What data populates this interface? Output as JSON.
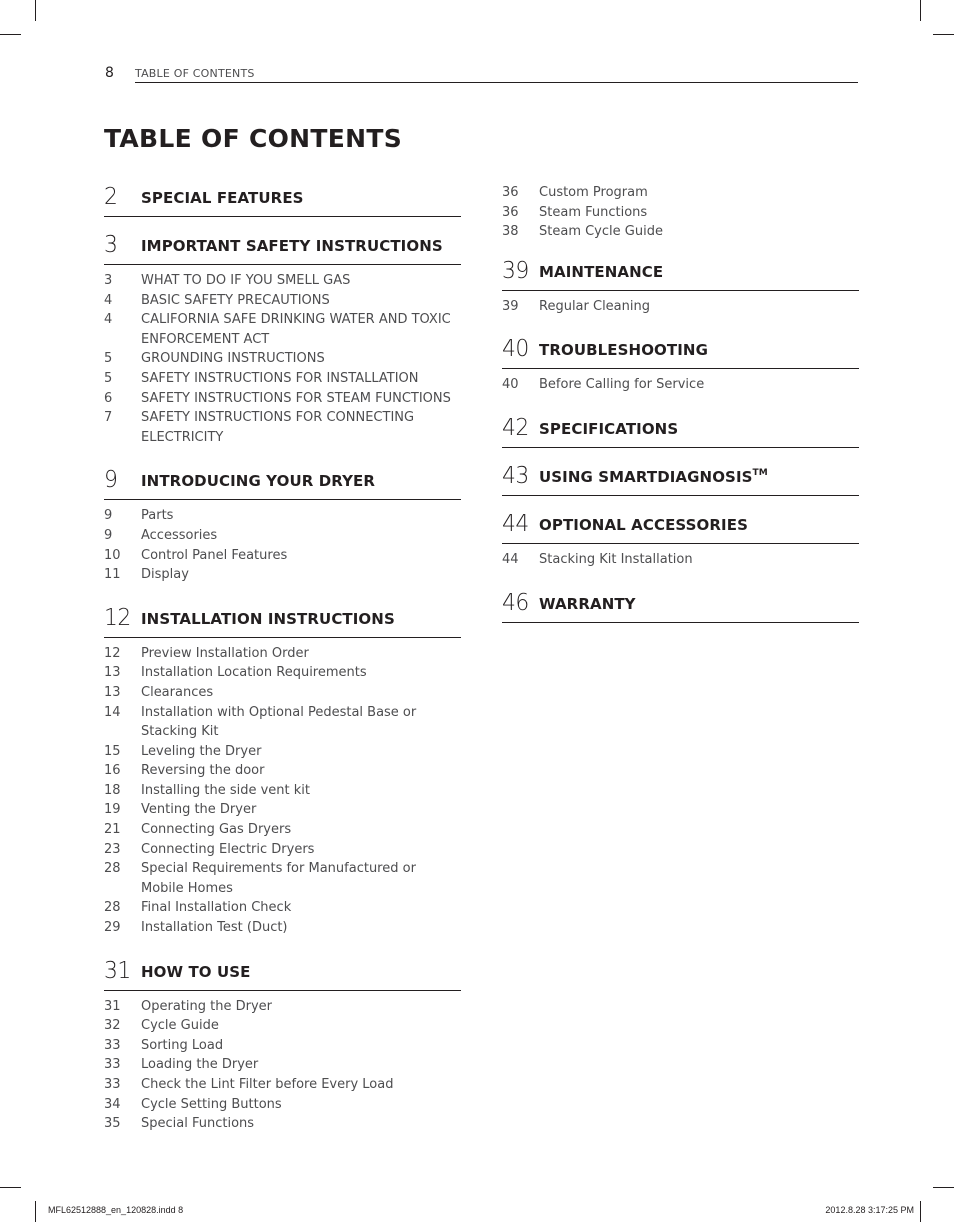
{
  "running_head": {
    "page_number": "8",
    "title": "TABLE OF CONTENTS"
  },
  "page_title": "TABLE OF CONTENTS",
  "left_column": [
    {
      "page": "2",
      "title": "SPECIAL FEATURES",
      "items": []
    },
    {
      "page": "3",
      "title": "IMPORTANT SAFETY INSTRUCTIONS",
      "items": [
        {
          "page": "3",
          "label": "WHAT TO DO IF YOU SMELL GAS"
        },
        {
          "page": "4",
          "label": "BASIC SAFETY PRECAUTIONS"
        },
        {
          "page": "4",
          "label": "CALIFORNIA SAFE DRINKING WATER AND TOXIC ENFORCEMENT ACT"
        },
        {
          "page": "5",
          "label": "GROUNDING INSTRUCTIONS"
        },
        {
          "page": "5",
          "label": "SAFETY INSTRUCTIONS FOR INSTALLATION"
        },
        {
          "page": "6",
          "label": "SAFETY INSTRUCTIONS FOR STEAM FUNCTIONS"
        },
        {
          "page": "7",
          "label": "SAFETY INSTRUCTIONS FOR CONNECTING ELECTRICITY"
        }
      ]
    },
    {
      "page": "9",
      "title": "INTRODUCING YOUR DRYER",
      "items": [
        {
          "page": "9",
          "label": "Parts"
        },
        {
          "page": "9",
          "label": "Accessories"
        },
        {
          "page": "10",
          "label": "Control Panel Features"
        },
        {
          "page": "11",
          "label": "Display"
        }
      ]
    },
    {
      "page": "12",
      "title": "INSTALLATION INSTRUCTIONS",
      "items": [
        {
          "page": "12",
          "label": "Preview Installation Order"
        },
        {
          "page": "13",
          "label": "Installation Location Requirements"
        },
        {
          "page": "13",
          "label": "Clearances"
        },
        {
          "page": "14",
          "label": "Installation with Optional Pedestal Base or Stacking Kit"
        },
        {
          "page": "15",
          "label": "Leveling the Dryer"
        },
        {
          "page": "16",
          "label": "Reversing the door"
        },
        {
          "page": "18",
          "label": "Installing the side vent kit"
        },
        {
          "page": "19",
          "label": "Venting the Dryer"
        },
        {
          "page": "21",
          "label": "Connecting Gas Dryers"
        },
        {
          "page": "23",
          "label": "Connecting Electric Dryers"
        },
        {
          "page": "28",
          "label": "Special Requirements for Manufactured or Mobile Homes"
        },
        {
          "page": "28",
          "label": "Final Installation Check"
        },
        {
          "page": "29",
          "label": "Installation Test (Duct)"
        }
      ]
    },
    {
      "page": "31",
      "title": "HOW TO USE",
      "items": [
        {
          "page": "31",
          "label": "Operating the Dryer"
        },
        {
          "page": "32",
          "label": "Cycle Guide"
        },
        {
          "page": "33",
          "label": "Sorting Load"
        },
        {
          "page": "33",
          "label": "Loading the Dryer"
        },
        {
          "page": "33",
          "label": "Check the Lint Filter before Every Load"
        },
        {
          "page": "34",
          "label": "Cycle Setting Buttons"
        },
        {
          "page": "35",
          "label": "Special Functions"
        }
      ]
    }
  ],
  "right_column": {
    "continued_items": [
      {
        "page": "36",
        "label": "Custom Program"
      },
      {
        "page": "36",
        "label": "Steam Functions"
      },
      {
        "page": "38",
        "label": "Steam Cycle Guide"
      }
    ],
    "sections": [
      {
        "page": "39",
        "title": "MAINTENANCE",
        "items": [
          {
            "page": "39",
            "label": "Regular Cleaning"
          }
        ]
      },
      {
        "page": "40",
        "title": "TROUBLESHOOTING",
        "items": [
          {
            "page": "40",
            "label": "Before Calling for Service"
          }
        ]
      },
      {
        "page": "42",
        "title": "SPECIFICATIONS",
        "items": []
      },
      {
        "page": "43",
        "title": "USING SMARTDIAGNOSIS",
        "title_sup": "TM",
        "items": []
      },
      {
        "page": "44",
        "title": "OPTIONAL ACCESSORIES",
        "items": [
          {
            "page": "44",
            "label": "Stacking Kit Installation"
          }
        ]
      },
      {
        "page": "46",
        "title": "WARRANTY",
        "items": []
      }
    ]
  },
  "slug": {
    "file": "MFL62512888_en_120828.indd   8",
    "timestamp": "2012.8.28   3:17:25 PM"
  }
}
